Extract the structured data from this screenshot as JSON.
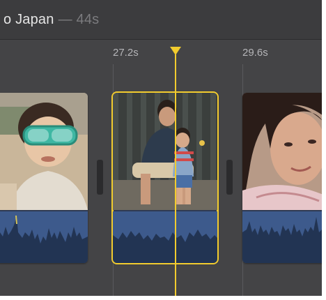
{
  "project": {
    "title": "o Japan",
    "duration": "— 44s"
  },
  "timeline": {
    "ruler": [
      {
        "label": "27.2s"
      },
      {
        "label": "29.6s"
      }
    ],
    "clips": [
      {
        "name": "clip-child-goggles",
        "selected": false
      },
      {
        "name": "clip-father-son-bench",
        "selected": true
      },
      {
        "name": "clip-woman-closeup",
        "selected": false
      }
    ]
  },
  "colors": {
    "accent": "#f2cc2e",
    "panel": "#444446",
    "audio": "#3d5a8c"
  },
  "icons": [
    "playhead-marker-icon"
  ]
}
